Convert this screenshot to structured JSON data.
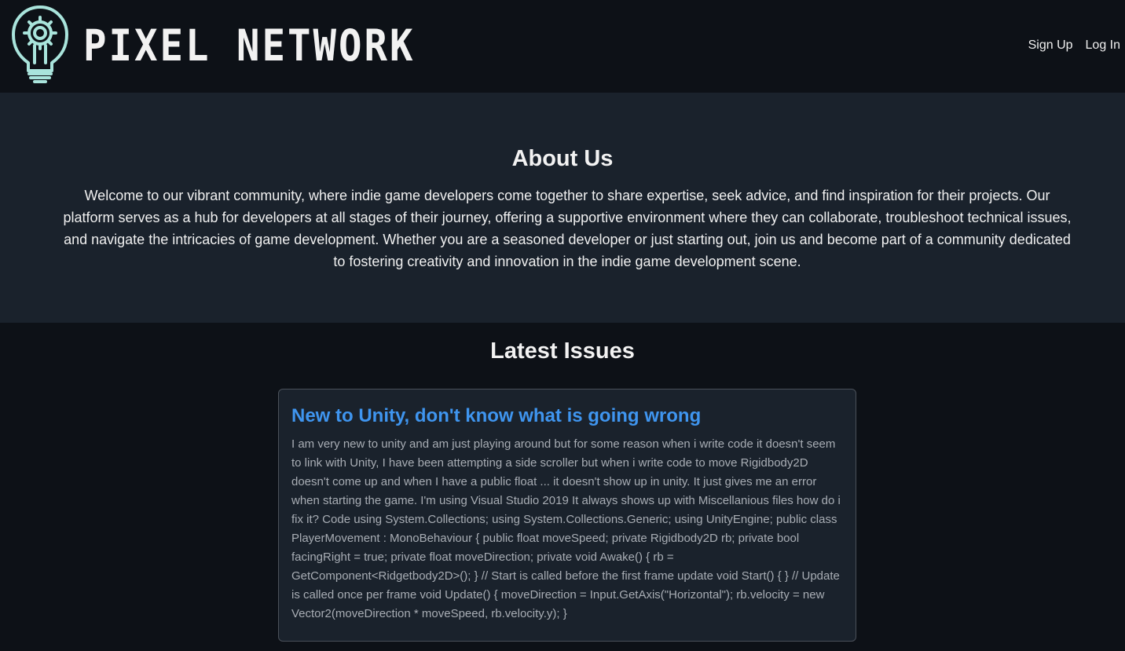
{
  "header": {
    "logo_text": "PIXEL NETWORK",
    "nav": {
      "sign_up": "Sign Up",
      "log_in": "Log In"
    }
  },
  "about": {
    "heading": "About Us",
    "text": "Welcome to our vibrant community, where indie game developers come together to share expertise, seek advice, and find inspiration for their projects. Our platform serves as a hub for developers at all stages of their journey, offering a supportive environment where they can collaborate, troubleshoot technical issues, and navigate the intricacies of game development. Whether you are a seasoned developer or just starting out, join us and become part of a community dedicated to fostering creativity and innovation in the indie game development scene."
  },
  "latest": {
    "heading": "Latest Issues",
    "issues": [
      {
        "title": "New to Unity, don't know what is going wrong",
        "body": "I am very new to unity and am just playing around but for some reason when i write code it doesn't seem to link with Unity, I have been attempting a side scroller but when i write code to move Rigidbody2D doesn't come up and when I have a public float ... it doesn't show up in unity. It just gives me an error when starting the game. I'm using Visual Studio 2019 It always shows up with Miscellanious files how do i fix it? Code using System.Collections; using System.Collections.Generic; using UnityEngine; public class PlayerMovement : MonoBehaviour { public float moveSpeed; private Rigidbody2D rb; private bool facingRight = true; private float moveDirection; private void Awake() { rb = GetComponent<Ridgetbody2D>(); } // Start is called before the first frame update void Start() { } // Update is called once per frame void Update() { moveDirection = Input.GetAxis(\"Horizontal\"); rb.velocity = new Vector2(moveDirection * moveSpeed, rb.velocity.y); }"
      }
    ]
  },
  "colors": {
    "page_bg": "#0d1117",
    "section_bg": "#1a222c",
    "accent_link": "#3f95ef",
    "logo_icon": "#a9e4dc"
  },
  "icons": {
    "logo": "lightbulb-gear-icon"
  }
}
